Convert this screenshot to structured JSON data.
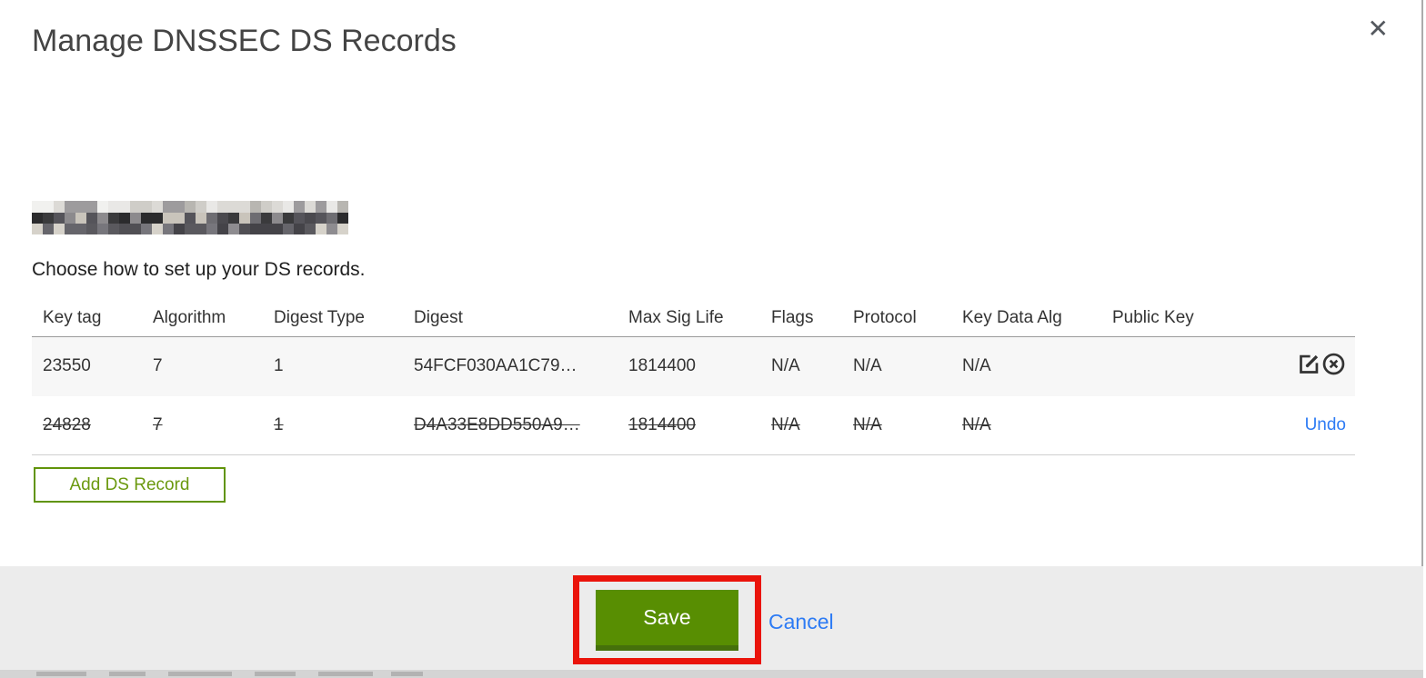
{
  "dialog": {
    "title": "Manage DNSSEC DS Records",
    "close_glyph": "✕",
    "subtitle": "Choose how to set up your DS records."
  },
  "table": {
    "columns": [
      "Key tag",
      "Algorithm",
      "Digest Type",
      "Digest",
      "Max Sig Life",
      "Flags",
      "Protocol",
      "Key Data Alg",
      "Public Key"
    ],
    "rows": [
      {
        "key_tag": "23550",
        "algorithm": "7",
        "digest_type": "1",
        "digest": "54FCF030AA1C79…",
        "max_sig_life": "1814400",
        "flags": "N/A",
        "protocol": "N/A",
        "key_data_alg": "N/A",
        "public_key": "",
        "deleted": false
      },
      {
        "key_tag": "24828",
        "algorithm": "7",
        "digest_type": "1",
        "digest": "D4A33E8DD550A9…",
        "max_sig_life": "1814400",
        "flags": "N/A",
        "protocol": "N/A",
        "key_data_alg": "N/A",
        "public_key": "",
        "deleted": true,
        "undo_label": "Undo"
      }
    ]
  },
  "buttons": {
    "add_ds_record": "Add DS Record",
    "save": "Save",
    "cancel": "Cancel"
  },
  "colors": {
    "accent_green": "#61940a",
    "save_green": "#588e02",
    "save_green_dark": "#45700b",
    "link_blue": "#2d7bf4",
    "annotation_red": "#ea140b",
    "footer_gray": "#ececec",
    "row_alt_gray": "#f7f7f7"
  },
  "redaction": {
    "present": true,
    "cols": 29,
    "rows": 3,
    "cell": 12,
    "row_palettes": [
      [
        "#e9e8e6",
        "#cfcdc8",
        "#b8b6b1",
        "#f1f1ef",
        "#9d9b9d",
        "#dcdad6"
      ],
      [
        "#3a3a3c",
        "#55545a",
        "#6e6d72",
        "#8c8a8d",
        "#2b2b2d",
        "#c9c4bb",
        "#4a494e"
      ],
      [
        "#5a595e",
        "#77767c",
        "#444348",
        "#8e8c90",
        "#66656b",
        "#d6d2ca",
        "#504f54"
      ]
    ]
  }
}
